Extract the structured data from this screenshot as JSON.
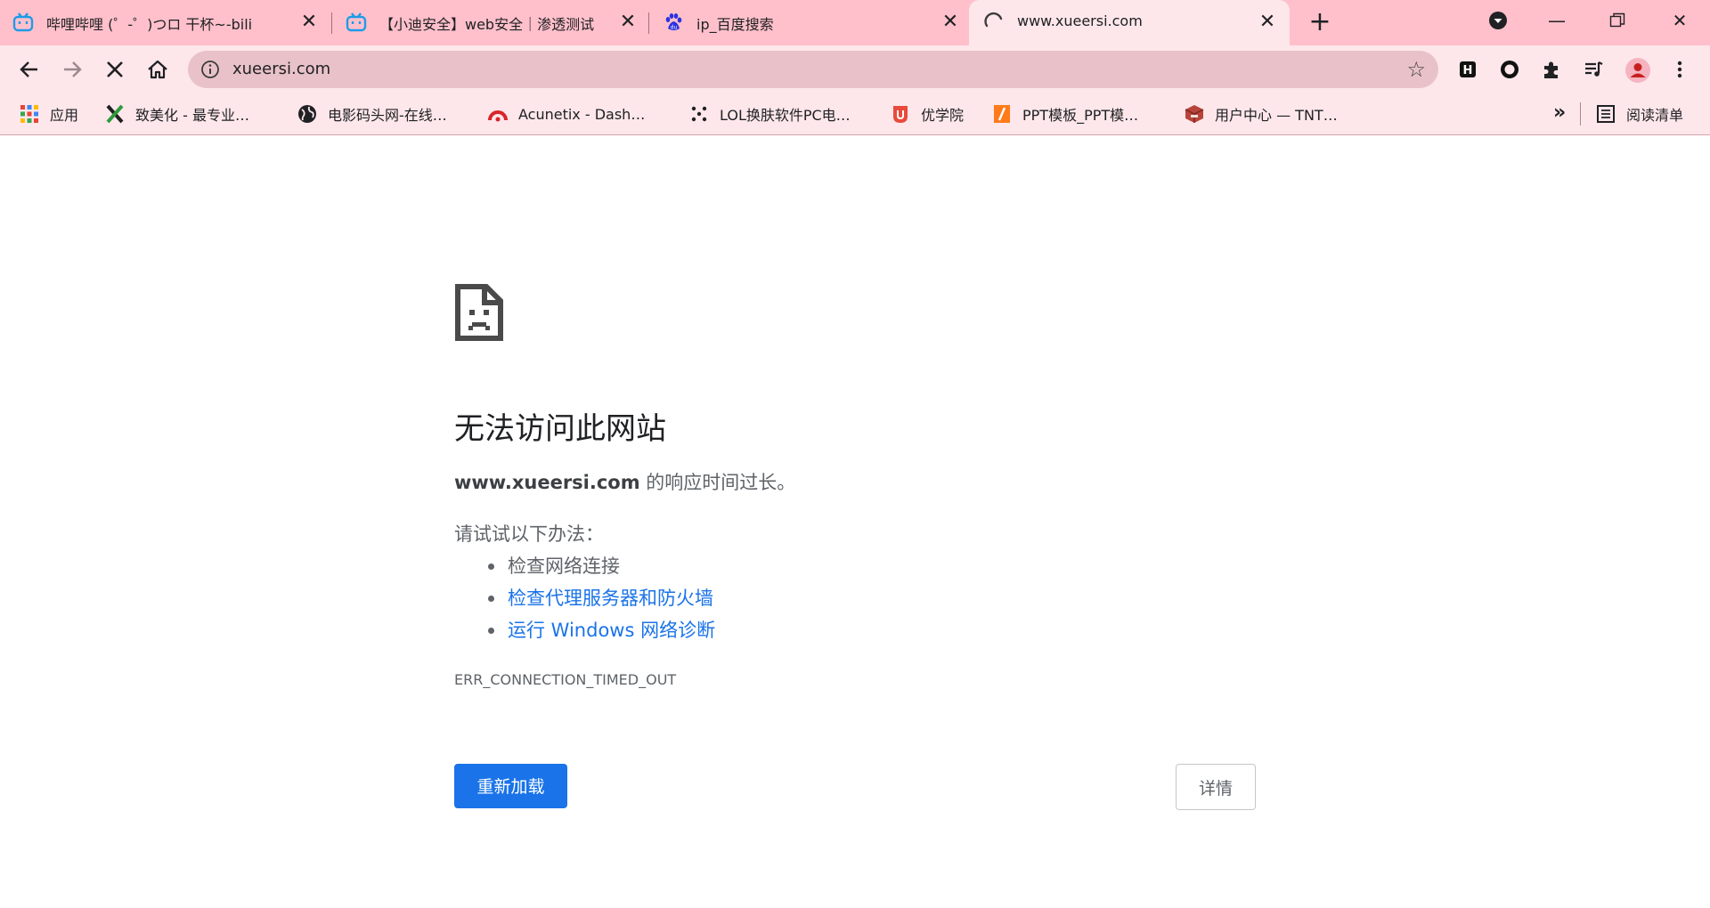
{
  "tabs": [
    {
      "title": "哔哩哔哩 (゜-゜)つロ 干杯~-bili",
      "favicon": "bilibili-icon"
    },
    {
      "title": "【小迪安全】web安全｜渗透测试",
      "favicon": "bilibili-icon"
    },
    {
      "title": "ip_百度搜索",
      "favicon": "baidu-paw-icon"
    },
    {
      "title": "www.xueersi.com",
      "favicon": "loading-spinner-icon",
      "active": true
    }
  ],
  "toolbar": {
    "url": "xueersi.com"
  },
  "bookmarks": [
    {
      "label": "应用",
      "icon": "apps-grid-icon"
    },
    {
      "label": "致美化 - 最专业…",
      "icon": "zhimeihua-x-icon"
    },
    {
      "label": "电影码头网-在线…",
      "icon": "globe-icon"
    },
    {
      "label": "Acunetix - Dash…",
      "icon": "acunetix-icon"
    },
    {
      "label": "LOL换肤软件PC电…",
      "icon": "dots-logo-icon"
    },
    {
      "label": "优学院",
      "icon": "ulearning-icon"
    },
    {
      "label": "PPT模板_PPT模…",
      "icon": "ppt-icon"
    },
    {
      "label": "用户中心 — TNT…",
      "icon": "tnt-icon"
    }
  ],
  "reading_list": "阅读清单",
  "error": {
    "title": "无法访问此网站",
    "host": "www.xueersi.com",
    "desc_suffix": " 的响应时间过长。",
    "try_label": "请试试以下办法：",
    "suggestions": [
      "检查网络连接",
      "检查代理服务器和防火墙",
      "运行 Windows 网络诊断"
    ],
    "code": "ERR_CONNECTION_TIMED_OUT",
    "reload_label": "重新加载",
    "details_label": "详情"
  },
  "colors": {
    "tabstrip": "#ffc0cb",
    "toolbar": "#fde7eb",
    "link": "#1a73e8",
    "button": "#1a73e8"
  }
}
